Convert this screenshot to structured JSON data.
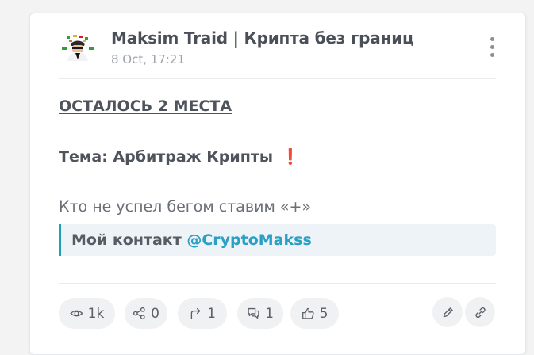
{
  "post": {
    "channel_name": "Maksim Traid | Крипта без границ",
    "date": "8 Oct, 17:21",
    "headline": "ОСТАЛОСЬ 2 МЕСТА",
    "topic": "Тема: Арбитраж Крипты",
    "topic_emoji": "❗",
    "call_to_action": "Кто не успел бегом ставим «+»",
    "contact_label": "Мой контакт",
    "contact_handle": "@CryptoMakss"
  },
  "stats": {
    "views": "1k",
    "shares": "0",
    "forwards": "1",
    "comments": "1",
    "likes": "5"
  },
  "icons": {
    "views": "eye-icon",
    "shares": "share-icon",
    "forwards": "forward-arrow-icon",
    "comments": "comments-icon",
    "likes": "thumbs-up-icon",
    "edit": "pencil-icon",
    "link": "link-icon",
    "menu": "more-vertical-icon"
  },
  "colors": {
    "accent": "#2b9fc4",
    "quote_border": "#1ea1b5",
    "alert": "#e0142b"
  }
}
